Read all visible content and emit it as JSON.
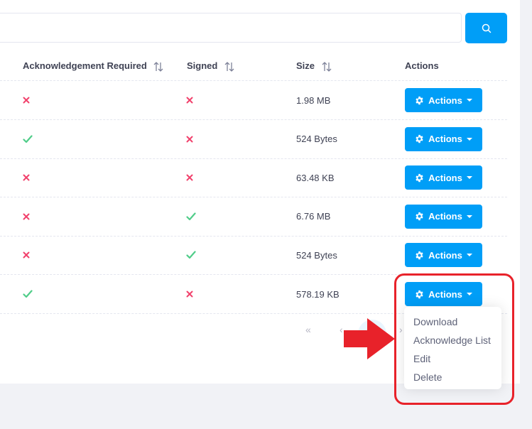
{
  "search": {
    "value": "",
    "placeholder": ""
  },
  "table": {
    "columns": [
      "Acknowledgement Required",
      "Signed",
      "Size",
      "Actions"
    ],
    "rows": [
      {
        "ack": false,
        "signed": false,
        "size": "1.98 MB",
        "action_label": "Actions"
      },
      {
        "ack": true,
        "signed": false,
        "size": "524 Bytes",
        "action_label": "Actions"
      },
      {
        "ack": false,
        "signed": false,
        "size": "63.48 KB",
        "action_label": "Actions"
      },
      {
        "ack": false,
        "signed": true,
        "size": "6.76 MB",
        "action_label": "Actions"
      },
      {
        "ack": false,
        "signed": true,
        "size": "524 Bytes",
        "action_label": "Actions"
      },
      {
        "ack": true,
        "signed": false,
        "size": "578.19 KB",
        "action_label": "Actions"
      }
    ]
  },
  "pagination": {
    "first": "«",
    "prev": "‹",
    "next": "›"
  },
  "dropdown": {
    "items": [
      "Download",
      "Acknowledge List",
      "Edit",
      "Delete"
    ]
  },
  "icons": {
    "search": "search-icon",
    "sort": "sort-icon",
    "gear": "gear-icon",
    "check": "check-icon",
    "cross": "cross-icon",
    "caret": "caret-down-icon",
    "arrow": "red-arrow-annotation"
  },
  "colors": {
    "primary": "#009ef7",
    "check": "#50cd89",
    "cross": "#f1416c",
    "annotation": "#e8222a"
  }
}
